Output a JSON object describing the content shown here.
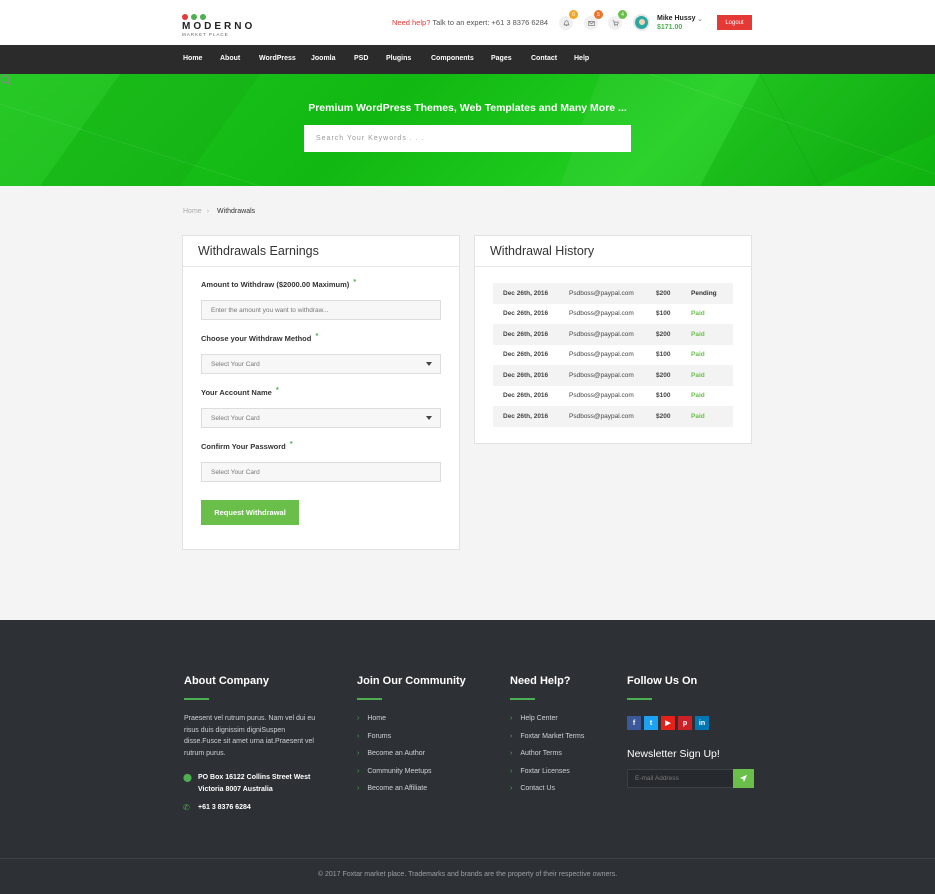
{
  "header": {
    "logo_text": "MODERNO",
    "logo_sub": "MARKET PLACE",
    "help_prefix": "Need help?",
    "help_text": "Talk to an expert:",
    "help_phone": "+61 3 8376 6284",
    "notifications_count": "0",
    "messages_count": "5",
    "cart_count": "4",
    "user_name": "Mike Hussy",
    "user_balance": "$171.00",
    "logout_label": "Logout"
  },
  "nav": {
    "items": [
      "Home",
      "About",
      "WordPress",
      "Joomla",
      "PSD",
      "Plugins",
      "Components",
      "Pages",
      "Contact",
      "Help"
    ]
  },
  "hero": {
    "title": "Premium WordPress Themes, Web Templates and Many More ...",
    "search_placeholder": "Search Your Keywords . . ."
  },
  "breadcrumb": {
    "home": "Home",
    "current": "Withdrawals"
  },
  "earnings": {
    "title": "Withdrawals Earnings",
    "amount_label": "Amount to Withdraw ($2000.00 Maximum)",
    "amount_placeholder": "Enter the amount you want to withdraw...",
    "method_label": "Choose your Withdraw Method",
    "method_value": "Select Your Card",
    "account_label": "Your Account Name",
    "account_value": "Select Your Card",
    "password_label": "Confirm Your Password",
    "password_value": "Select Your Card",
    "submit_label": "Request Withdrawal"
  },
  "history": {
    "title": "Withdrawal History",
    "rows": [
      {
        "date": "Dec 26th, 2016",
        "email": "Psdboss@paypal.com",
        "amount": "$200",
        "status": "Pending"
      },
      {
        "date": "Dec 26th, 2016",
        "email": "Psdboss@paypal.com",
        "amount": "$100",
        "status": "Paid"
      },
      {
        "date": "Dec 26th, 2016",
        "email": "Psdboss@paypal.com",
        "amount": "$200",
        "status": "Paid"
      },
      {
        "date": "Dec 26th, 2016",
        "email": "Psdboss@paypal.com",
        "amount": "$100",
        "status": "Paid"
      },
      {
        "date": "Dec 26th, 2016",
        "email": "Psdboss@paypal.com",
        "amount": "$200",
        "status": "Paid"
      },
      {
        "date": "Dec 26th, 2016",
        "email": "Psdboss@paypal.com",
        "amount": "$100",
        "status": "Paid"
      },
      {
        "date": "Dec 26th, 2016",
        "email": "Psdboss@paypal.com",
        "amount": "$200",
        "status": "Paid"
      }
    ]
  },
  "footer": {
    "about_title": "About Company",
    "about_text": "Praesent vel rutrum purus. Nam vel dui eu risus duis dignissim digniSuspen disse.Fusce sit amet urna iat.Praesent vel rutrum purus.",
    "address_line1": "PO Box 16122 Collins Street West",
    "address_line2": "Victoria 8007 Australia",
    "phone": "+61 3 8376 6284",
    "community_title": "Join Our Community",
    "community_links": [
      "Home",
      "Forums",
      "Become an Author",
      "Community Meetups",
      "Become an Affiliate"
    ],
    "help_title": "Need Help?",
    "help_links": [
      "Help Center",
      "Foxtar Market Terms",
      "Author Terms",
      "Foxtar Licenses",
      "Contact Us"
    ],
    "follow_title": "Follow Us On",
    "newsletter_title": "Newsletter Sign Up!",
    "email_placeholder": "E-mail Address",
    "copyright": "© 2017 Foxtar market place. Trademarks and brands are the property of their respective owners."
  },
  "colors": {
    "accent": "#4caf50",
    "danger": "#e53935",
    "nav_bg": "#2b2b2b",
    "footer_bg": "#2d3135",
    "hero_green": "#11b811"
  }
}
